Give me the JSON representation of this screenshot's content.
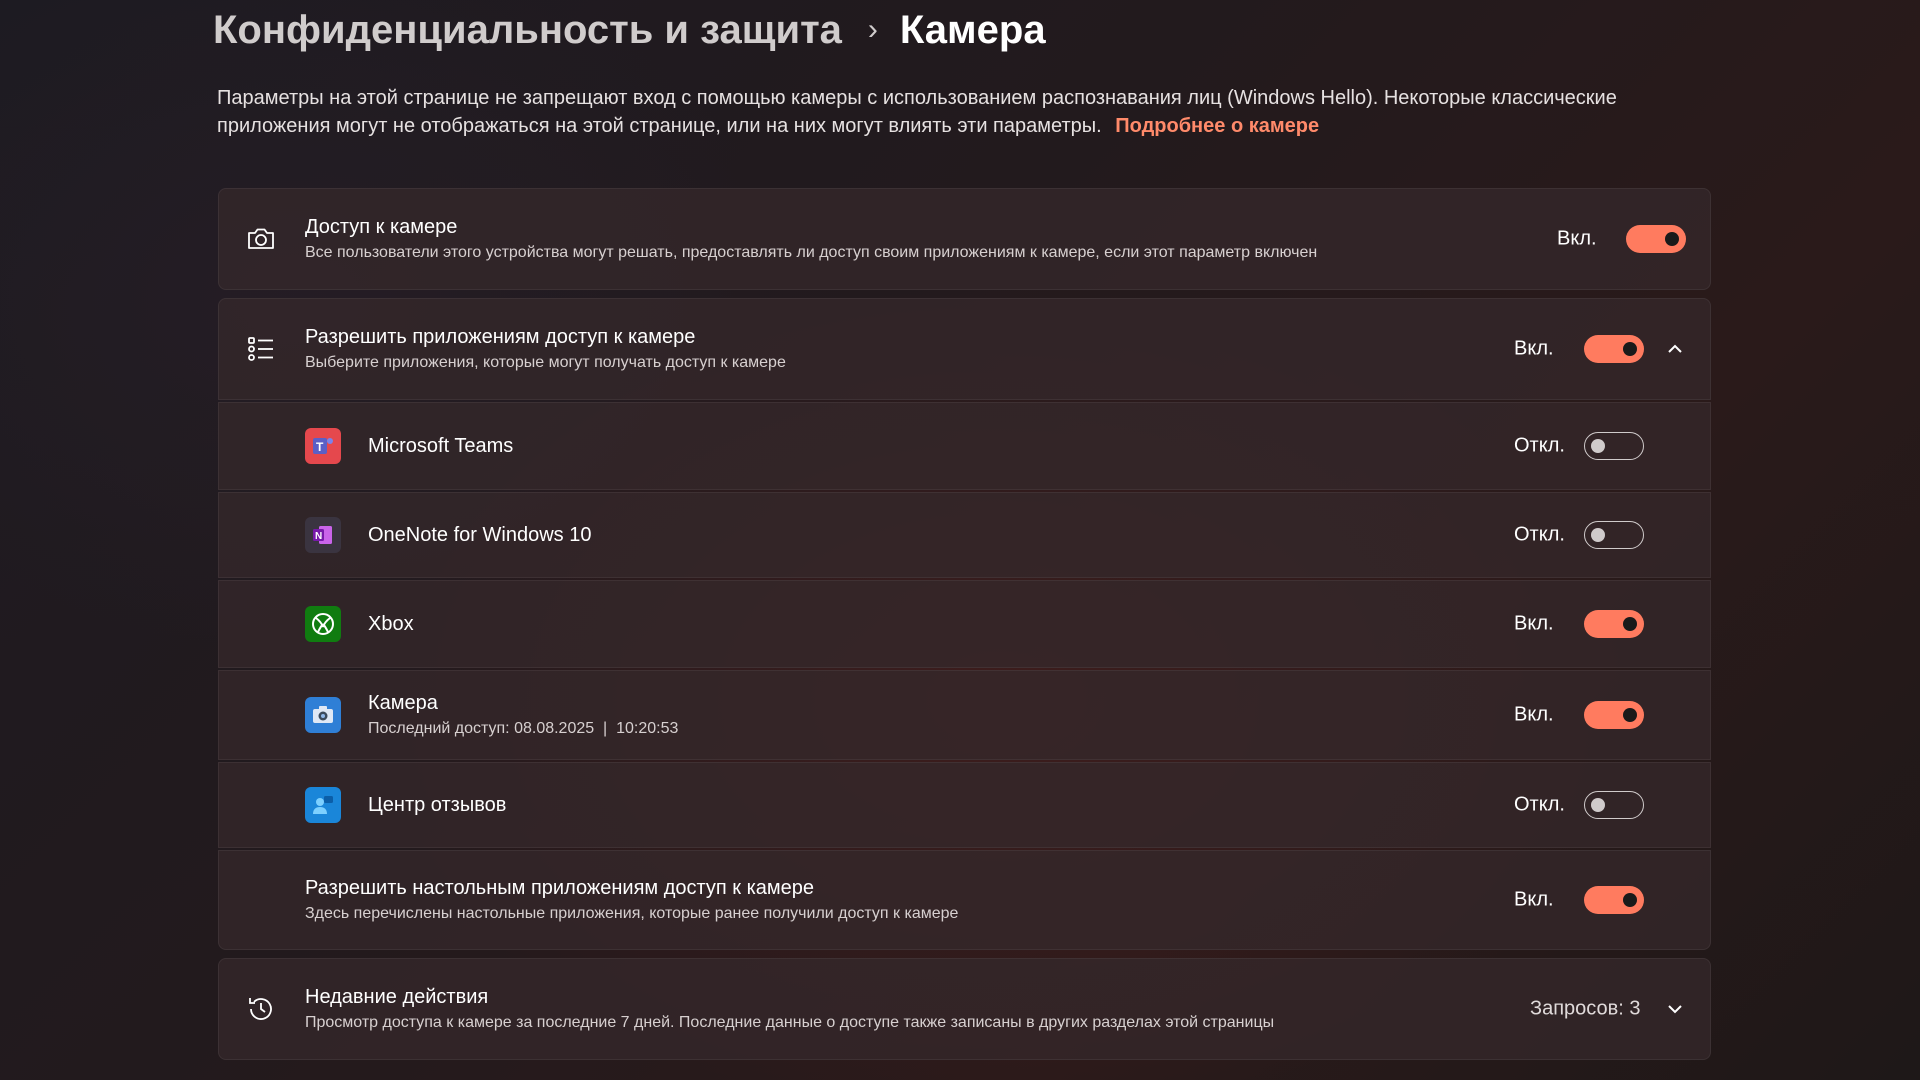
{
  "breadcrumb": {
    "parent": "Конфиденциальность и защита",
    "separator": "›",
    "current": "Камера"
  },
  "description": {
    "text": "Параметры на этой странице не запрещают вход с помощью камеры с использованием распознавания лиц (Windows Hello). Некоторые классические приложения могут не отображаться на этой странице, или на них могут влиять эти параметры.",
    "link": "Подробнее о камере"
  },
  "colors": {
    "accent": "#ff7b5f",
    "link": "#ff8a6a",
    "card": "#34282a"
  },
  "camera_access": {
    "icon": "camera-icon",
    "title": "Доступ к камере",
    "subtitle": "Все пользователи этого устройства могут решать, предоставлять ли доступ своим приложениям к камере, если этот параметр включен",
    "state": "Вкл.",
    "on": true
  },
  "allow_apps": {
    "icon": "list-icon",
    "title": "Разрешить приложениям доступ к камере",
    "subtitle": "Выберите приложения, которые могут получать доступ к камере",
    "state": "Вкл.",
    "on": true,
    "expanded": true
  },
  "apps": [
    {
      "name": "Microsoft Teams",
      "subtitle": "",
      "state": "Откл.",
      "on": false,
      "icon": "teams-icon"
    },
    {
      "name": "OneNote for Windows 10",
      "subtitle": "",
      "state": "Откл.",
      "on": false,
      "icon": "onenote-icon"
    },
    {
      "name": "Xbox",
      "subtitle": "",
      "state": "Вкл.",
      "on": true,
      "icon": "xbox-icon"
    },
    {
      "name": "Камера",
      "subtitle": "Последний доступ: 08.08.2025  |  10:20:53",
      "state": "Вкл.",
      "on": true,
      "icon": "camera-app-icon"
    },
    {
      "name": "Центр отзывов",
      "subtitle": "",
      "state": "Откл.",
      "on": false,
      "icon": "feedback-hub-icon"
    }
  ],
  "desktop_apps": {
    "title": "Разрешить настольным приложениям доступ к камере",
    "subtitle": "Здесь перечислены настольные приложения, которые ранее получили доступ к камере",
    "state": "Вкл.",
    "on": true
  },
  "recent": {
    "icon": "history-icon",
    "title": "Недавние действия",
    "subtitle": "Просмотр доступа к камере за последние 7 дней. Последние данные о доступе также записаны в других разделах этой страницы",
    "count": "Запросов: 3"
  }
}
